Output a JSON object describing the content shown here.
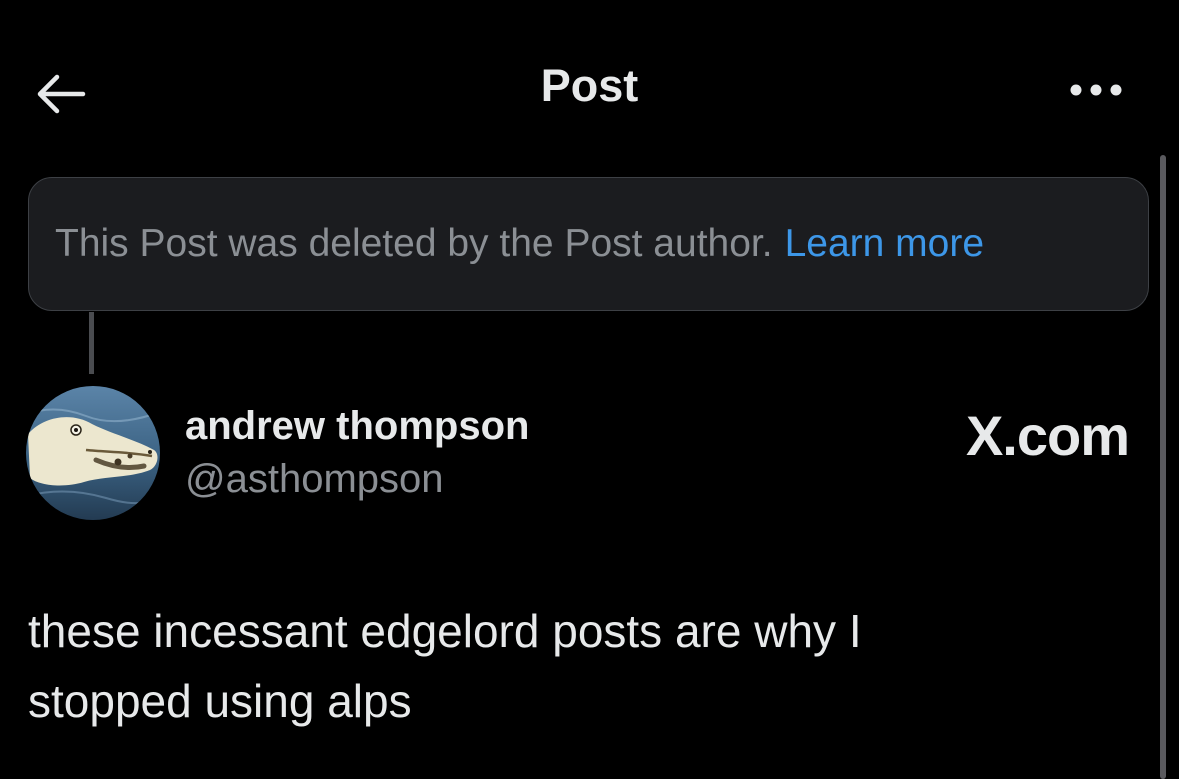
{
  "header": {
    "title": "Post",
    "back_icon": "arrow-left-icon",
    "more_icon": "more-horizontal-icon"
  },
  "deleted_notice": {
    "text": "This Post was deleted by the Post author.",
    "link": "Learn more"
  },
  "author": {
    "display_name": "andrew thompson",
    "handle": "@asthompson",
    "avatar_icon": "alligator-avatar"
  },
  "watermark": "X.com",
  "post": {
    "text_line1": "these incessant edgelord posts are why I",
    "text_line2": "stopped using alps"
  },
  "colors": {
    "background": "#000000",
    "text_primary": "#e7e9ea",
    "text_secondary": "#8b8f94",
    "link": "#3d97e8",
    "notice_bg": "#1b1c1f"
  }
}
